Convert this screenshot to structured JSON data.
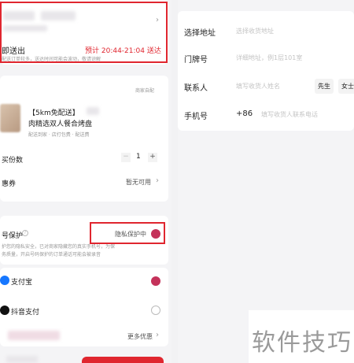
{
  "left": {
    "eta_label": "即送出",
    "eta_note": "配送订单较多，送达时间可能会波动，敬请谅解",
    "eta_value": "预计 20:44-21:04 送达",
    "shop_tag": "商家自配",
    "product_title": "【5km免配送】",
    "product_subtitle": "肉精选双人餐合烤盘",
    "product_tags": "配送到家 · 店打包费 · 配送费",
    "qty_label": "买份数",
    "qty_minus": "−",
    "qty_value": "1",
    "qty_plus": "+",
    "coupon_label": "惠券",
    "coupon_value": "暂无可用",
    "privacy_label": "号保护",
    "privacy_status": "隐私保护中",
    "privacy_desc_1": "护您的隐私安全，已对商家隐藏您的真实手机号，为保",
    "privacy_desc_2": "务质量，开启号码保护的订单通话可能会被录音",
    "pay_alipay": "支付宝",
    "pay_douyin": "抖音支付",
    "more_offers": "更多优惠",
    "watermark": "软件技巧"
  },
  "right": {
    "addr_label": "选择地址",
    "addr_placeholder": "选择收货地址",
    "door_label": "门牌号",
    "door_placeholder": "详细地址，例1层101室",
    "contact_label": "联系人",
    "contact_placeholder": "填写收货人姓名",
    "gender_mr": "先生",
    "gender_ms": "女士",
    "phone_label": "手机号",
    "phone_code": "+86",
    "phone_placeholder": "填写收货人联系电话"
  },
  "colors": {
    "accent": "#e0262f",
    "pink": "#c4325a",
    "alipay": "#1677ff"
  }
}
